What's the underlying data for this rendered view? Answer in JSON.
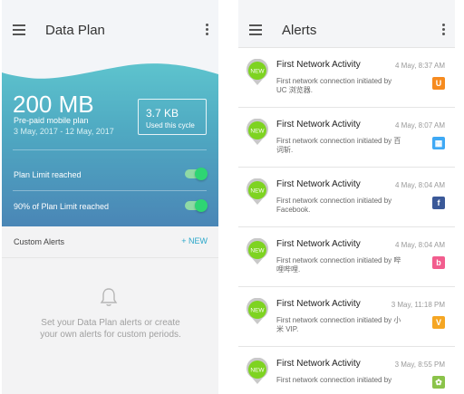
{
  "data_plan": {
    "title": "Data Plan",
    "usage_amount": "200 MB",
    "plan_type": "Pre-paid mobile plan",
    "plan_dates": "3 May, 2017 - 12 May, 2017",
    "cycle_value": "3.7 KB",
    "cycle_label": "Used this cycle",
    "plan_limit_label": "Plan Limit reached",
    "plan_limit_enabled": true,
    "ninety_percent_label": "90% of Plan Limit reached",
    "ninety_percent_enabled": true,
    "custom_alerts_label": "Custom Alerts",
    "new_button_label": "+ NEW",
    "empty_message": "Set your Data Plan alerts or create your own alerts for custom periods."
  },
  "alerts": {
    "title": "Alerts",
    "items": [
      {
        "badge": "NEW",
        "title": "First Network Activity",
        "time": "4 May, 8:37 AM",
        "body": "First network connection initiated by UC 浏览器.",
        "app_icon": "uc-browser-icon",
        "icon_color": "#f68b1f",
        "icon_glyph": "U"
      },
      {
        "badge": "NEW",
        "title": "First Network Activity",
        "time": "4 May, 8:07 AM",
        "body": "First network connection initiated by 百词斩.",
        "app_icon": "baicizhan-icon",
        "icon_color": "#3fa9f5",
        "icon_glyph": "▦"
      },
      {
        "badge": "NEW",
        "title": "First Network Activity",
        "time": "4 May, 8:04 AM",
        "body": "First network connection initiated by Facebook.",
        "app_icon": "facebook-icon",
        "icon_color": "#3b5998",
        "icon_glyph": "f"
      },
      {
        "badge": "NEW",
        "title": "First Network Activity",
        "time": "4 May, 8:04 AM",
        "body": "First network connection initiated by 哔哩哔哩.",
        "app_icon": "bilibili-icon",
        "icon_color": "#f25d8e",
        "icon_glyph": "b"
      },
      {
        "badge": "NEW",
        "title": "First Network Activity",
        "time": "3 May, 11:18 PM",
        "body": "First network connection initiated by 小米 VIP.",
        "app_icon": "xiaomi-vip-icon",
        "icon_color": "#f5a623",
        "icon_glyph": "V"
      },
      {
        "badge": "NEW",
        "title": "First Network Activity",
        "time": "3 May, 8:55 PM",
        "body": "First network connection initiated by",
        "app_icon": "android-app-icon",
        "icon_color": "#8bc34a",
        "icon_glyph": "✿"
      }
    ]
  }
}
